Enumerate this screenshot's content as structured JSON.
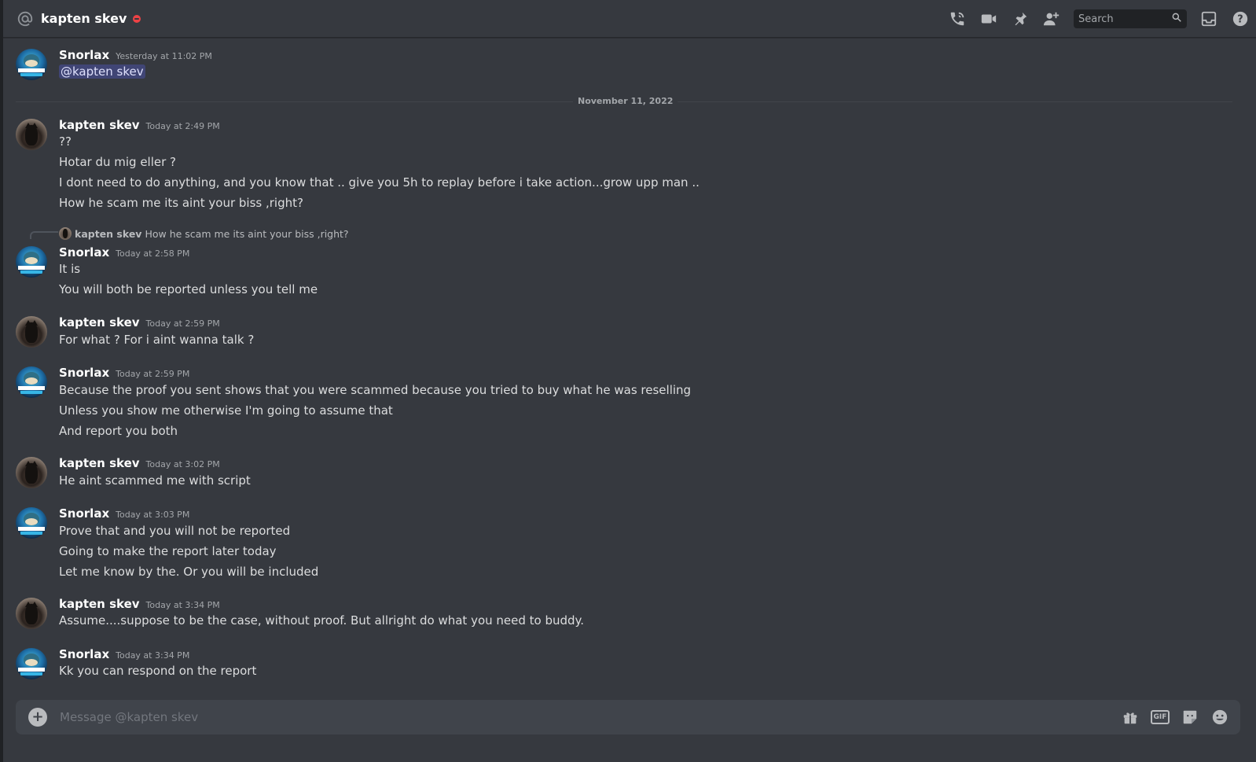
{
  "header": {
    "title": "kapten skev",
    "search_placeholder": "Search"
  },
  "divider": "November 11, 2022",
  "messages": [
    {
      "author": "Snorlax",
      "time": "Yesterday at 11:02 PM",
      "lines": [
        "@kapten skev"
      ]
    },
    {
      "author": "kapten skev",
      "time": "Today at 2:49 PM",
      "lines": [
        "??",
        "Hotar du mig eller ?",
        "I dont need to do anything,  and you know that .. give you 5h to replay before i take action...grow upp  man ..",
        "How he scam me its aint your biss ,right?"
      ]
    },
    {
      "author": "Snorlax",
      "time": "Today at 2:58 PM",
      "reply": {
        "author": "kapten skev",
        "text": "How he scam me its aint your biss ,right?"
      },
      "lines": [
        "It is",
        "You will both be reported unless you tell me"
      ]
    },
    {
      "author": "kapten skev",
      "time": "Today at 2:59 PM",
      "lines": [
        "For what ? For i aint wanna talk ?"
      ]
    },
    {
      "author": "Snorlax",
      "time": "Today at 2:59 PM",
      "lines": [
        "Because the proof you sent shows that you were scammed because you tried to buy what he was reselling",
        "Unless you show me otherwise I'm going to assume that",
        "And report you both"
      ]
    },
    {
      "author": "kapten skev",
      "time": "Today at 3:02 PM",
      "lines": [
        "He aint scammed me  with script"
      ]
    },
    {
      "author": "Snorlax",
      "time": "Today at 3:03 PM",
      "lines": [
        "Prove that and you will not be reported",
        "Going to make the report later today",
        "Let me know by the. Or you will be included"
      ]
    },
    {
      "author": "kapten skev",
      "time": "Today at 3:34 PM",
      "lines": [
        "Assume....suppose to be the case, without proof. But allright do what you need to buddy."
      ]
    },
    {
      "author": "Snorlax",
      "time": "Today at 3:34 PM",
      "lines": [
        "Kk you can respond on the report"
      ]
    }
  ],
  "composer": {
    "placeholder": "Message @kapten skev",
    "gif_label": "GIF"
  },
  "colors": {
    "background": "#36393f",
    "dnd_status": "#ed4245",
    "mention_bg": "#5865f24d"
  }
}
